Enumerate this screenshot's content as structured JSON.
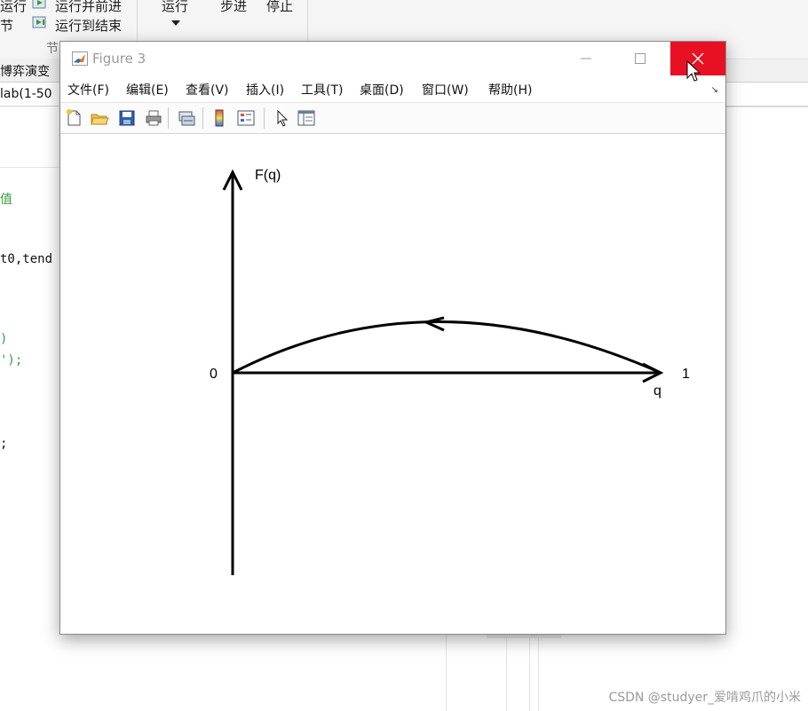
{
  "ide": {
    "ribbon": {
      "run_section_label_top": "运行",
      "run_section_label_bottom": "节",
      "run_and_advance_label": "运行并前进",
      "run_to_end_label": "运行到结束",
      "run_label": "运行",
      "step_label": "步进",
      "stop_label": "停止",
      "section_group_label": "节"
    },
    "tab_label": "博弈演变",
    "path_text": "lab(1-50",
    "code_lines": [
      {
        "text": "值",
        "color": "#3a9a3a"
      },
      {
        "text": "t0,tend",
        "color": "#111111"
      },
      {
        "text": ")",
        "color": "#3a9a3a"
      },
      {
        "text": "');",
        "color": "#3a9a3a"
      },
      {
        "text": ";",
        "color": "#111111"
      }
    ],
    "watermark": "CSDN @studyer_爱啃鸡爪的小米"
  },
  "figure": {
    "title": "Figure 3",
    "menu": [
      "文件(F)",
      "编辑(E)",
      "查看(V)",
      "插入(I)",
      "工具(T)",
      "桌面(D)",
      "窗口(W)",
      "帮助(H)"
    ],
    "toolbar_icons": [
      "new-figure-icon",
      "open-file-icon",
      "save-icon",
      "print-icon",
      "link-plot-icon",
      "colorbar-icon",
      "legend-icon",
      "edit-plot-icon",
      "property-inspector-icon"
    ],
    "plot": {
      "y_axis_label": "F(q)",
      "x_axis_label": "q",
      "origin_label": "0",
      "x_end_label": "1"
    }
  },
  "colors": {
    "close_button": "#e81123",
    "code_comment": "#3a9a3a"
  }
}
